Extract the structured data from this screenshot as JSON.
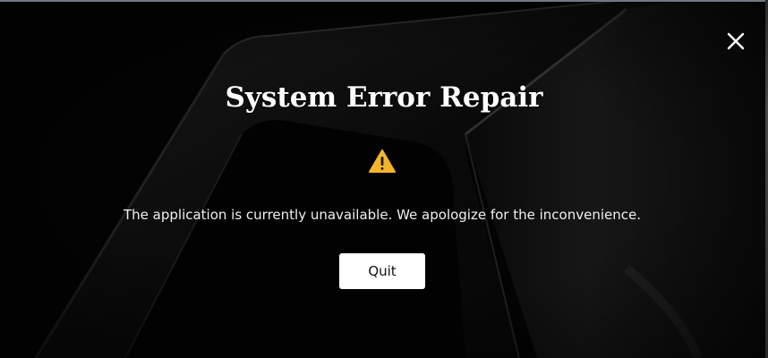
{
  "dialog": {
    "title": "System Error Repair",
    "message": "The application is currently unavailable. We apologize for the inconvenience.",
    "quit_label": "Quit",
    "warning_icon": "warning-triangle",
    "close_icon": "close-x"
  },
  "colors": {
    "background": "#030303",
    "title_text": "#ffffff",
    "warning_fill": "#f5b52a",
    "button_bg": "#ffffff",
    "button_text": "#111111"
  }
}
